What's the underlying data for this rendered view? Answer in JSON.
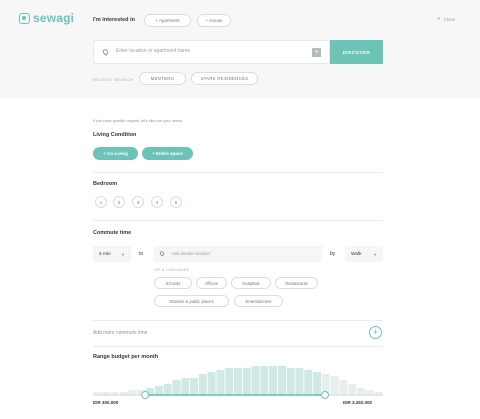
{
  "brand": {
    "name": "sewagi"
  },
  "header": {
    "interested_label": "I'm interested in",
    "property_types": [
      "+ Apartment",
      "+ House"
    ],
    "close_label": "Close"
  },
  "search": {
    "placeholder": "Enter location or apartment name",
    "discover_label": "DISCOVER",
    "recent_label": "RECENT SEARCH",
    "recent_items": [
      "MENTENG",
      "1PARK RESIDENCES"
    ]
  },
  "filters": {
    "hint": "If you have specific request, let's filter out your needs",
    "living_condition": {
      "title": "Living Condition",
      "options": [
        "+ Co-Living",
        "+ Entire space"
      ]
    },
    "bedroom": {
      "title": "Bedroom",
      "options": [
        "1",
        "2",
        "3",
        "4",
        "5"
      ]
    },
    "commute": {
      "title": "Commute time",
      "duration": "5 min",
      "to_label": "to",
      "location_placeholder": "Add details location",
      "by_label": "by",
      "mode": "Walk",
      "landmark_label": "OR A LANDMARK",
      "landmarks": [
        "Schools",
        "Offices",
        "Hospitals",
        "Restaurants",
        "Stations & public places",
        "Entertainment"
      ],
      "add_more_label": "Add more commute time"
    },
    "budget": {
      "title": "Range budget per month",
      "min_label": "IDR 400.000",
      "max_label": "IDR 3.262.000",
      "histogram": [
        2,
        2,
        2,
        2,
        3,
        3,
        4,
        5,
        6,
        8,
        9,
        9,
        11,
        12,
        13,
        14,
        14,
        14,
        15,
        15,
        15,
        15,
        14,
        14,
        13,
        12,
        11,
        10,
        8,
        6,
        4,
        3,
        2
      ],
      "range_start": 0.18,
      "range_end": 0.8
    }
  },
  "colors": {
    "accent": "#6cc4b6",
    "bar": "#cfe9e4",
    "bar_faded": "#e8eeee"
  }
}
